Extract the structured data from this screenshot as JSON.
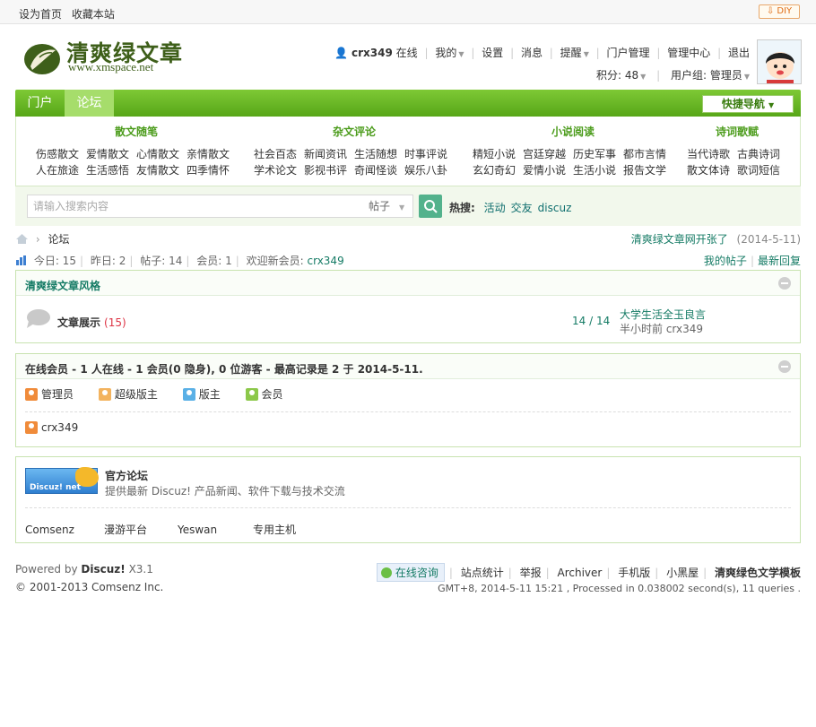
{
  "topbar": {
    "set_home": "设为首页",
    "bookmark": "收藏本站",
    "diy": "DIY"
  },
  "logo": {
    "title": "清爽绿文章",
    "url": "www.xmspace.net"
  },
  "userbar": {
    "username": "crx349",
    "status": "在线",
    "mine": "我的",
    "settings": "设置",
    "messages": "消息",
    "remind": "提醒",
    "portal_admin": "门户管理",
    "admin_center": "管理中心",
    "logout": "退出",
    "points": "积分: 48",
    "usergroup": "用户组: 管理员"
  },
  "nav": {
    "tabs": [
      {
        "label": "门户"
      },
      {
        "label": "论坛"
      }
    ],
    "quicknav": "快捷导航"
  },
  "categories": [
    {
      "head": "散文随笔",
      "rows": [
        [
          "伤感散文",
          "爱情散文",
          "心情散文",
          "亲情散文"
        ],
        [
          "人在旅途",
          "生活感悟",
          "友情散文",
          "四季情怀"
        ]
      ]
    },
    {
      "head": "杂文评论",
      "rows": [
        [
          "社会百态",
          "新闻资讯",
          "生活随想",
          "时事评说"
        ],
        [
          "学术论文",
          "影视书评",
          "奇闻怪谈",
          "娱乐八卦"
        ]
      ]
    },
    {
      "head": "小说阅读",
      "rows": [
        [
          "精短小说",
          "宫廷穿越",
          "历史军事",
          "都市言情"
        ],
        [
          "玄幻奇幻",
          "爱情小说",
          "生活小说",
          "报告文学"
        ]
      ]
    },
    {
      "head": "诗词歌赋",
      "rows": [
        [
          "当代诗歌",
          "古典诗词"
        ],
        [
          "散文体诗",
          "歌词短信"
        ]
      ]
    }
  ],
  "search": {
    "placeholder": "请输入搜索内容",
    "type": "帖子",
    "hot_label": "热搜:",
    "hot": [
      "活动",
      "交友",
      "discuz"
    ]
  },
  "breadcrumb": {
    "current": "论坛",
    "news_link": "清爽绿文章网开张了",
    "news_date": "(2014-5-11)"
  },
  "stats": {
    "today": "今日: 15",
    "yesterday": "昨日: 2",
    "posts": "帖子: 14",
    "members": "会员: 1",
    "welcome": "欢迎新会员:",
    "newest": "crx349",
    "my_posts": "我的帖子",
    "latest_reply": "最新回复"
  },
  "forum_group": {
    "title": "清爽绿文章风格",
    "forum_name": "文章展示",
    "forum_new": "(15)",
    "counts": "14 / 14",
    "last_title": "大学生活全玉良言",
    "last_meta": "半小时前 crx349"
  },
  "online": {
    "title": "在线会员 - 1 人在线 - 1 会员(0 隐身), 0 位游客 - 最高记录是 2 于 2014-5-11.",
    "legend": [
      "管理员",
      "超级版主",
      "版主",
      "会员"
    ],
    "member": "crx349"
  },
  "official": {
    "logo_text": "Discuz! net",
    "name": "官方论坛",
    "desc": "提供最新 Discuz! 产品新闻、软件下载与技术交流",
    "links": [
      "Comsenz",
      "漫游平台",
      "Yeswan",
      "专用主机"
    ]
  },
  "footer": {
    "powered_prefix": "Powered by",
    "powered_name": "Discuz!",
    "version": "X3.1",
    "copyright": "© 2001-2013 Comsenz Inc.",
    "online_consult": "在线咨询",
    "links": [
      "站点统计",
      "举报",
      "Archiver",
      "手机版",
      "小黑屋"
    ],
    "template": "清爽绿色文学模板",
    "debug": "GMT+8, 2014-5-11 15:21 , Processed in 0.038002 second(s), 11 queries ."
  },
  "colors": {
    "brand_green": "#57a618",
    "link_teal": "#157b65",
    "accent_orange": "#e06d16"
  }
}
